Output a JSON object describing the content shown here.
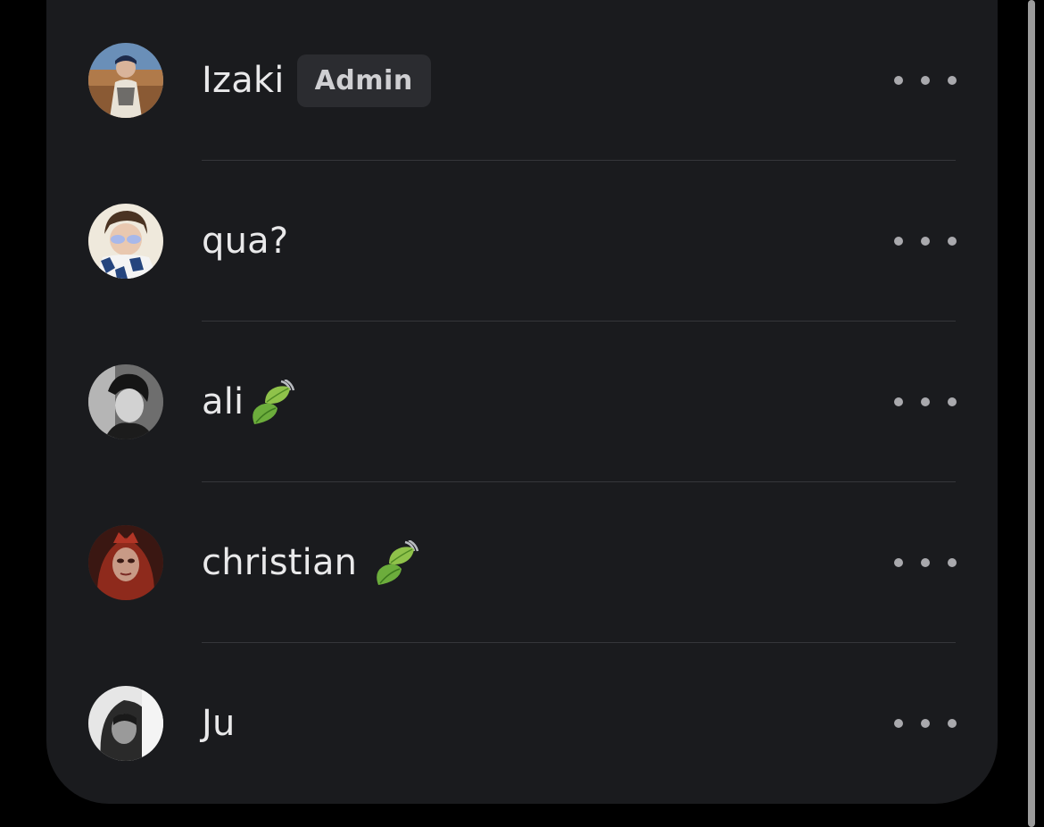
{
  "members": [
    {
      "name": "Izaki",
      "badge": "Admin",
      "emoji": "",
      "avatar": "avatar-desert-photo"
    },
    {
      "name": "qua?",
      "badge": "",
      "emoji": "",
      "avatar": "avatar-sunglasses-photo"
    },
    {
      "name": "ali",
      "badge": "",
      "emoji": "leaf-fluttering-emoji",
      "avatar": "avatar-monochrome-photo"
    },
    {
      "name": "christian",
      "badge": "",
      "emoji": "leaf-fluttering-emoji",
      "avatar": "avatar-red-hair-photo"
    },
    {
      "name": "Ju",
      "badge": "",
      "emoji": "",
      "avatar": "avatar-grayscale-photo"
    }
  ],
  "more_icon": "more-horizontal-icon",
  "colors": {
    "background": "#000000",
    "card": "#1a1b1e",
    "text": "#e9e9ea",
    "badge_bg": "#2b2c30",
    "divider": "#35363a",
    "dots": "#a9a9ad"
  }
}
